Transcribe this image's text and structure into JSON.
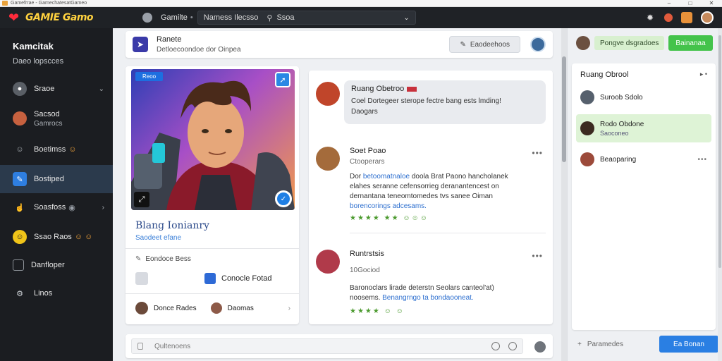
{
  "window": {
    "title": "Gamefrrae - GamechatesatGameo"
  },
  "topbar": {
    "logo_text": "GAMIE Gamo",
    "nav_label": "Gamilte",
    "nav_sep": "•",
    "search_value": "Namess Ilecsso",
    "search_secondary": "Ssoa"
  },
  "sidebar": {
    "header_title": "Kamcitak",
    "header_sub": "Daeo lopscces",
    "items": [
      {
        "label": "Sraoe",
        "sub": ""
      },
      {
        "label": "Sacsod",
        "sub": "Gamrocs"
      },
      {
        "label": "Boetimss",
        "sub": ""
      },
      {
        "label": "Bostiped",
        "sub": ""
      },
      {
        "label": "Soasfoss",
        "sub": ""
      },
      {
        "label": "Ssao Raos",
        "sub": ""
      },
      {
        "label": "Danfloper",
        "sub": ""
      },
      {
        "label": "Linos",
        "sub": ""
      }
    ]
  },
  "profile_bar": {
    "name": "Ranete",
    "desc": "Detloecoondoe dor Oinpea",
    "button": "Eaodeehoos"
  },
  "game_card": {
    "badge": "Reoo",
    "title": "Blang Ionianry",
    "subtitle": "Saodeet efane",
    "row1": "Eondoce Bess",
    "tile_label": "Conocle Fotad",
    "foot1": "Donce Rades",
    "foot2": "Daomas"
  },
  "feed": {
    "post1": {
      "name": "Ruang Obetroo",
      "text1": "Coel Dortegeer sterope fectre bang ests lmding!",
      "text2": "Daogars"
    },
    "post2": {
      "name": "Soet Poao",
      "meta": "Ctooperars",
      "line1": "Dor",
      "line1_hl": "betoomatnaloe",
      "line1_rest": "doola Brat Paono hancholanek",
      "line2": "elahes seranne cefensorrieg deranantencest on",
      "line3": "dernantana teneomtomedes tvs sanee Oiman",
      "line4_hl": "borencorings adcesams.",
      "reactions": "★★★★ ★★ ☺☺☺"
    },
    "post3": {
      "name": "Runtrstsis",
      "meta": "10Gociod",
      "line1": "Baronoclars lirade deterstn Seolars canteol'at)",
      "line2": "noosems.",
      "line2_hl": "Benangrngo ta bondaooneat.",
      "reactions": "★★★★ ☺ ☺"
    }
  },
  "composer": {
    "placeholder": "Qultenoens"
  },
  "right_panel": {
    "chip": "Pongve dsgradoes",
    "green_button": "Bainanaa",
    "header": "Ruang Obrool",
    "header_ctl": "▸ •",
    "items": [
      {
        "name": "Suroob Sdolo",
        "sub": ""
      },
      {
        "name": "Rodo Obdone",
        "sub": "Saoconeo"
      },
      {
        "name": "Beaoparing",
        "sub": ""
      }
    ],
    "bottom_input": "Paramedes",
    "bottom_button": "Ea Bonan"
  }
}
